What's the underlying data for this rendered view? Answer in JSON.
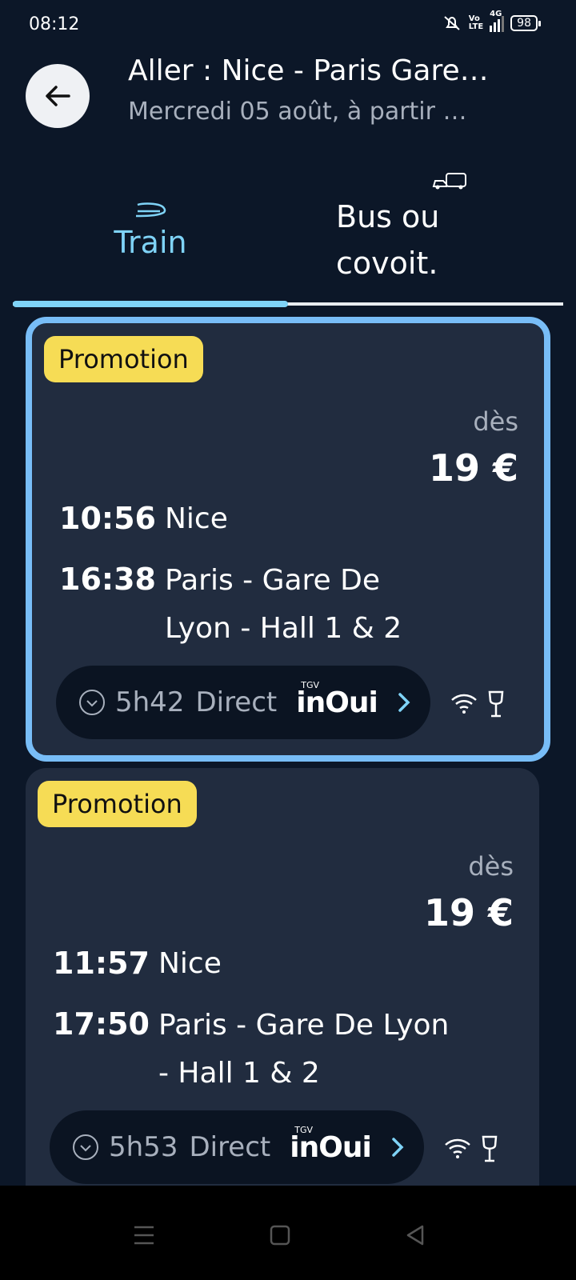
{
  "status": {
    "time": "08:12",
    "network": "4G",
    "battery": "98"
  },
  "header": {
    "title": "Aller : Nice - Paris Gare…",
    "subtitle": "Mercredi 05 août, à partir …"
  },
  "tabs": [
    {
      "label": "Train",
      "icon": "train-icon",
      "active": true
    },
    {
      "label_line1": "Bus ou",
      "label_line2": "covoit.",
      "icon": "bus-car-icon",
      "active": false
    }
  ],
  "results": [
    {
      "badge": "Promotion",
      "price_prefix": "dès",
      "price": "19 €",
      "depart_time": "10:56",
      "depart_station": "Nice",
      "arrive_time": "16:38",
      "arrive_station_line1": "Paris - Gare De",
      "arrive_station_line2": "Lyon - Hall 1 & 2",
      "duration": "5h42",
      "type": "Direct",
      "brand_top": "TGV",
      "brand": "inOui"
    },
    {
      "badge": "Promotion",
      "price_prefix": "dès",
      "price": "19 €",
      "depart_time": "11:57",
      "depart_station": "Nice",
      "arrive_time": "17:50",
      "arrive_station_line1": "Paris - Gare De Lyon",
      "arrive_station_line2": "- Hall 1 & 2",
      "duration": "5h53",
      "type": "Direct",
      "brand_top": "TGV",
      "brand": "inOui"
    }
  ],
  "colors": {
    "background": "#0c1728",
    "card": "#212c3f",
    "accent": "#7fd3f7",
    "selected_border": "#78bdf7",
    "promo": "#f6dc55"
  }
}
